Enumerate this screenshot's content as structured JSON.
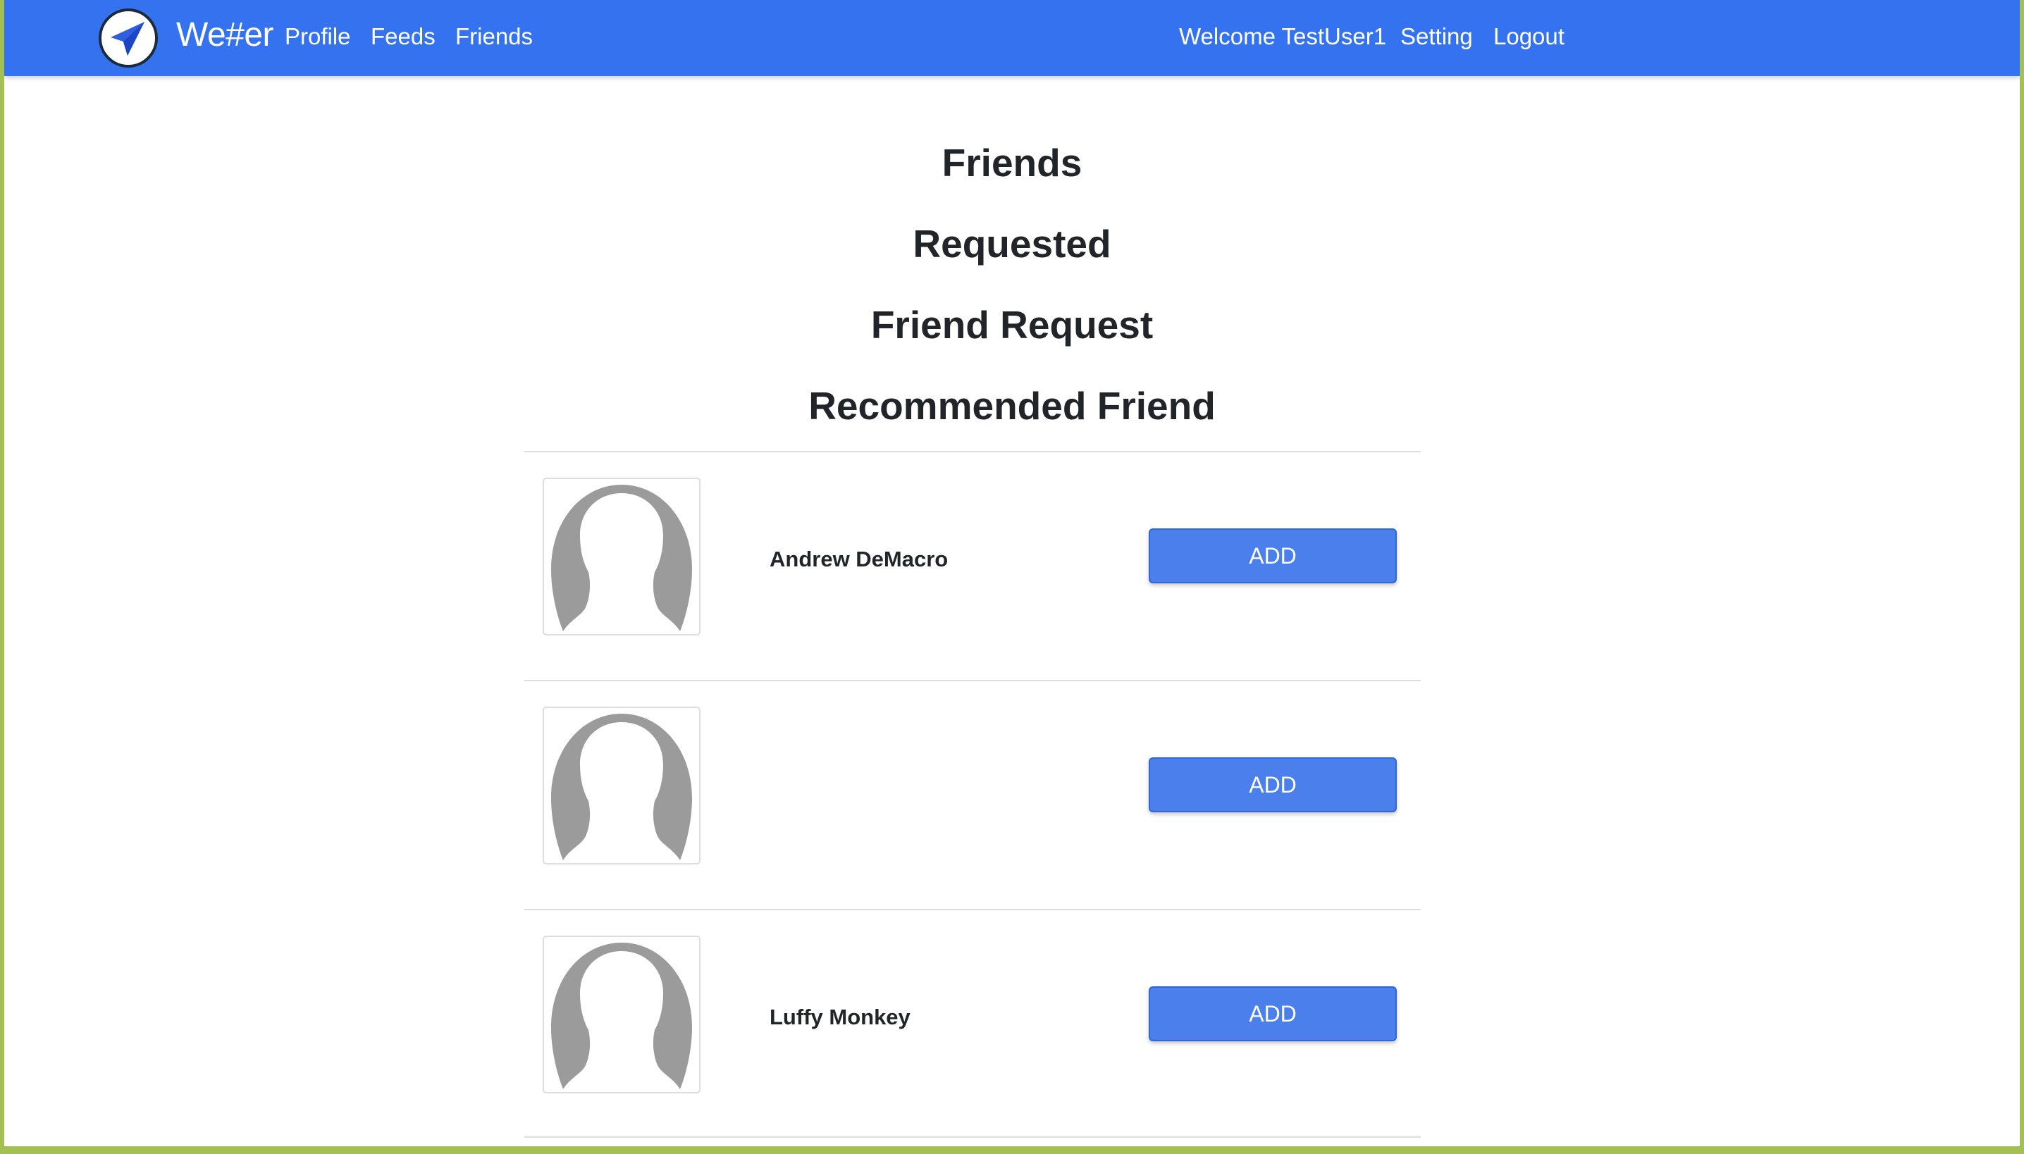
{
  "navbar": {
    "brand": "We#er",
    "links": [
      {
        "label": "Profile"
      },
      {
        "label": "Feeds"
      },
      {
        "label": "Friends"
      }
    ],
    "welcome": "Welcome TestUser1",
    "setting": "Setting",
    "logout": "Logout",
    "logo_icon": "paper-plane-icon"
  },
  "sections": {
    "friends": "Friends",
    "requested": "Requested",
    "friend_request": "Friend Request",
    "recommended": "Recommended Friend"
  },
  "recommended_friends": [
    {
      "name": "Andrew DeMacro",
      "button": "ADD",
      "avatar_icon": "default-avatar-icon"
    },
    {
      "name": "",
      "button": "ADD",
      "avatar_icon": "default-avatar-icon"
    },
    {
      "name": "Luffy Monkey",
      "button": "ADD",
      "avatar_icon": "default-avatar-icon"
    }
  ],
  "colors": {
    "navbar": "#3572ef",
    "button": "#4a7fec",
    "frame": "#a3c152"
  }
}
